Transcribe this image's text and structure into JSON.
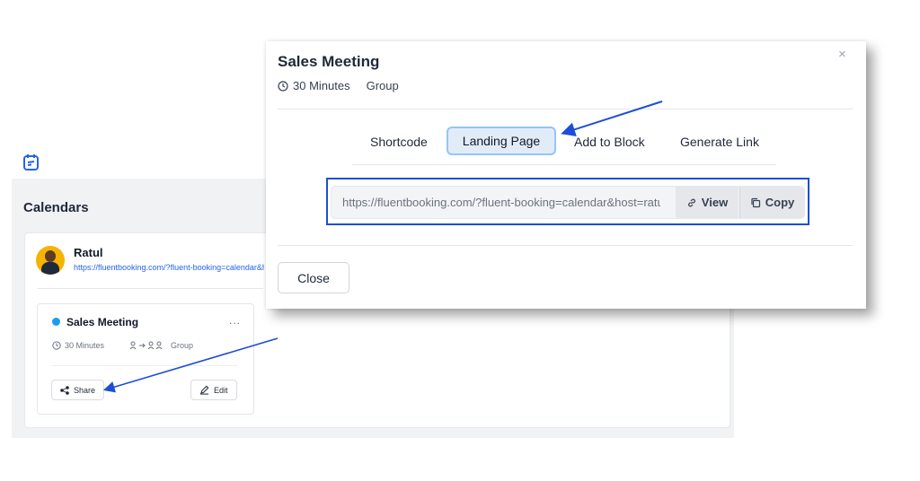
{
  "background": {
    "section_title": "Calendars",
    "user": {
      "name": "Ratul",
      "link": "https://fluentbooking.com/?fluent-booking=calendar&ho"
    },
    "event_card": {
      "title": "Sales Meeting",
      "more": "...",
      "duration": "30 Minutes",
      "type": "Group",
      "share_label": "Share",
      "edit_label": "Edit"
    }
  },
  "modal": {
    "title": "Sales Meeting",
    "duration": "30 Minutes",
    "type": "Group",
    "tabs": [
      {
        "label": "Shortcode",
        "active": false
      },
      {
        "label": "Landing Page",
        "active": true
      },
      {
        "label": "Add to Block",
        "active": false
      },
      {
        "label": "Generate Link",
        "active": false
      }
    ],
    "url": "https://fluentbooking.com/?fluent-booking=calendar&host=ratul&event=sales-meeting",
    "view_label": "View",
    "copy_label": "Copy",
    "close_label": "Close",
    "close_icon": "×"
  },
  "colors": {
    "accent": "#2563eb",
    "annotation_arrow": "#1d4ed8",
    "active_tab_bg": "#e2ecf9",
    "event_dot": "#1d9bf0"
  }
}
